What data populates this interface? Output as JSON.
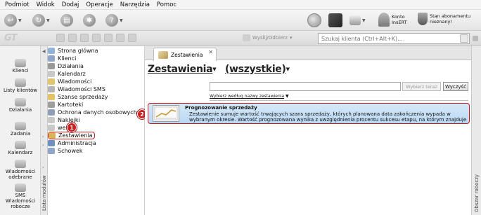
{
  "menu": [
    "Podmiot",
    "Widok",
    "Dodaj",
    "Operacje",
    "Narzędzia",
    "Pomoc"
  ],
  "header": {
    "account_label": "Konto\nInsERT",
    "subscription_label": "Stan abonamentu\nnieznany!"
  },
  "subbar": {
    "logo": "GT",
    "send_label": "Wyślij/Odbierz",
    "search_placeholder": "Szukaj klienta (Ctrl+Alt+K)..."
  },
  "sidebar": {
    "items": [
      {
        "label": "Klienci",
        "icon": "clients-icon"
      },
      {
        "label": "Listy klientów",
        "icon": "client-lists-icon"
      },
      {
        "label": "Działania",
        "icon": "actions-icon"
      },
      {
        "label": "Zadania",
        "icon": "tasks-icon"
      },
      {
        "label": "Kalendarz",
        "icon": "calendar-icon"
      },
      {
        "label": "Wiadomości odebrane",
        "icon": "inbox-icon"
      },
      {
        "label": "SMS Wiadomości robocze",
        "icon": "sms-icon"
      }
    ],
    "vertical_label": "Lista modułów"
  },
  "modules": [
    "Strona główna",
    "Klienci",
    "Działania",
    "Kalendarz",
    "Wiadomości",
    "Wiadomości SMS",
    "Szanse sprzedaży",
    "Kartoteki",
    "Ochrona danych osobowych",
    "Naklejki",
    "wersje",
    "Zestawienia",
    "Administracja",
    "Schowek"
  ],
  "callouts": {
    "one": "1",
    "two": "2"
  },
  "main": {
    "tab_label": "Zestawienia",
    "tab_close": "✕",
    "title": "Zestawienia",
    "filter_value": "(wszystkie)",
    "clear_button": "Wybierz teraz",
    "search_button": "Wyczyść",
    "choose_by_name": "Wybierz według nazwy zestawienia",
    "report": {
      "title": "Prognozowanie sprzedaży",
      "description": "Zestawienie sumuje wartość trwających szans sprzedaży, których planowana data zakończenia wypada w wybranym okresie. Wartość prognozowana wynika z uwzględnienia procentu sukcesu etapu, na którym znajduje"
    }
  },
  "right_panel": {
    "vertical_label": "Obszar roboczy"
  },
  "colors": {
    "highlight": "#d01818",
    "report_bg": "#c5def5"
  }
}
